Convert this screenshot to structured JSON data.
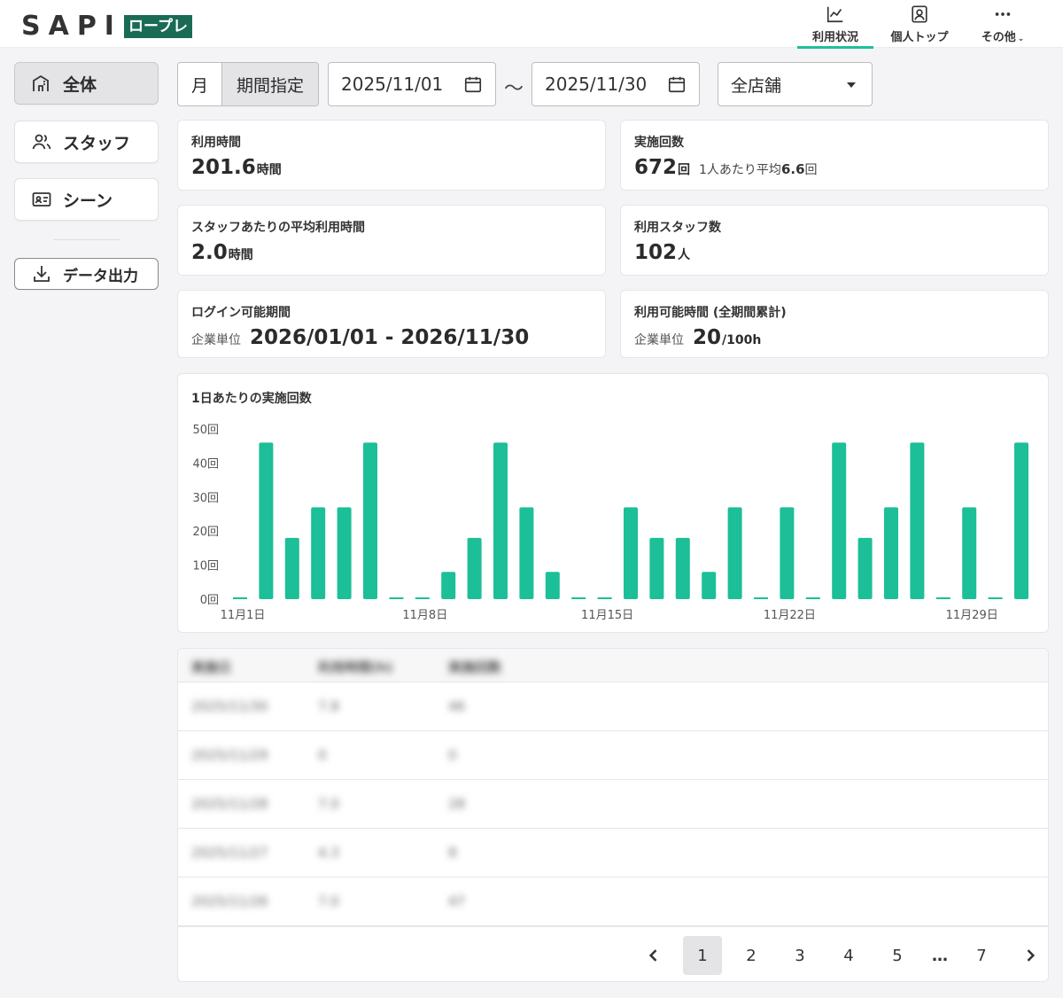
{
  "header": {
    "logo_text": "SAPI",
    "logo_badge": "ロープレ",
    "nav": {
      "usage": "利用状況",
      "personal": "個人トップ",
      "other": "その他"
    }
  },
  "sidebar": {
    "all": "全体",
    "staff": "スタッフ",
    "scene": "シーン",
    "export": "データ出力"
  },
  "toolbar": {
    "month": "月",
    "range": "期間指定",
    "start_date": "2025/11/01",
    "tilde": "〜",
    "end_date": "2025/11/30",
    "store": "全店舗"
  },
  "cards": {
    "usage_time": {
      "title": "利用時間",
      "value": "201.6",
      "unit": "時間"
    },
    "sessions": {
      "title": "実施回数",
      "value": "672",
      "unit": "回",
      "sub_prefix": "1人あたり平均",
      "sub_value": "6.6",
      "sub_unit": "回"
    },
    "avg_time": {
      "title": "スタッフあたりの平均利用時間",
      "value": "2.0",
      "unit": "時間"
    },
    "staff_count": {
      "title": "利用スタッフ数",
      "value": "102",
      "unit": "人"
    },
    "login_period": {
      "title": "ログイン可能期間",
      "prefix": "企業単位",
      "value": "2026/01/01 - 2026/11/30"
    },
    "available_time": {
      "title": "利用可能時間 (全期間累計)",
      "prefix": "企業単位",
      "value": "20",
      "unit": "/100h"
    }
  },
  "chart_data": {
    "type": "bar",
    "title": "1日あたりの実施回数",
    "bar_color": "#1cbf97",
    "ylim": [
      0,
      50
    ],
    "y_ticks": [
      "50回",
      "40回",
      "30回",
      "20回",
      "10回",
      "0回"
    ],
    "x_tick_labels": [
      "11月1日",
      "11月8日",
      "11月15日",
      "11月22日",
      "11月29日"
    ],
    "categories": [
      "11/1",
      "11/2",
      "11/3",
      "11/4",
      "11/5",
      "11/6",
      "11/7",
      "11/8",
      "11/9",
      "11/10",
      "11/11",
      "11/12",
      "11/13",
      "11/14",
      "11/15",
      "11/16",
      "11/17",
      "11/18",
      "11/19",
      "11/20",
      "11/21",
      "11/22",
      "11/23",
      "11/24",
      "11/25",
      "11/26",
      "11/27",
      "11/28",
      "11/29",
      "11/30"
    ],
    "values": [
      0,
      46,
      18,
      27,
      27,
      46,
      0,
      0,
      8,
      18,
      46,
      27,
      8,
      0,
      0,
      27,
      18,
      18,
      8,
      27,
      0,
      27,
      0,
      46,
      18,
      27,
      46,
      0,
      27,
      0,
      46
    ]
  },
  "table": {
    "headers": [
      "実施日",
      "利用時間(h)",
      "実施回数"
    ],
    "rows": [
      [
        "2025/11/30",
        "7.8",
        "46"
      ],
      [
        "2025/11/29",
        "0",
        "0"
      ],
      [
        "2025/11/28",
        "7.0",
        "28"
      ],
      [
        "2025/11/27",
        "4.3",
        "8"
      ],
      [
        "2025/11/26",
        "7.0",
        "47"
      ]
    ]
  },
  "pagination": {
    "pages": [
      "1",
      "2",
      "3",
      "4",
      "5",
      "…",
      "7"
    ],
    "current": "1"
  }
}
